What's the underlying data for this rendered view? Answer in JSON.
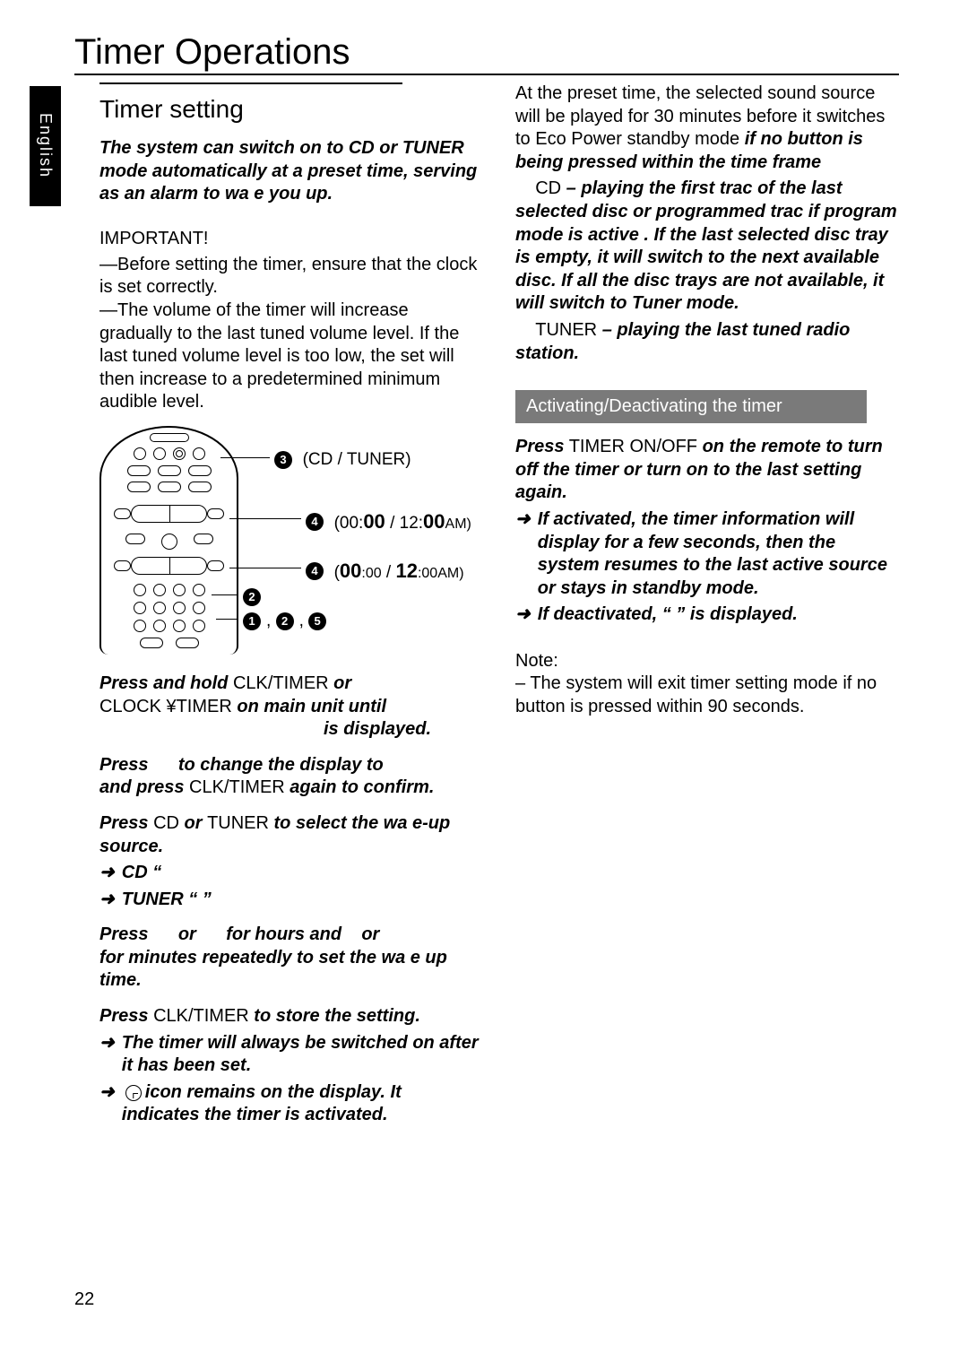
{
  "page_title": "Timer Operations",
  "language_tab": "English",
  "page_number": "22",
  "left": {
    "section_title": "Timer setting",
    "intro": "The system can switch on to CD or TUNER mode automatically at a preset time, serving as an alarm to wa e you up.",
    "important_head": "IMPORTANT!",
    "important_p1": "—Before setting the timer, ensure that the clock is set correctly.",
    "important_p2": "—The volume of the timer will increase gradually to the last tuned volume level. If the last tuned volume level is too low, the set will then increase to a predetermined minimum audible level.",
    "callouts": {
      "c3": "(CD / TUNER)",
      "c4a_pre": "(00:",
      "c4a_big": "00",
      "c4a_mid": " / 12:",
      "c4a_big2": "00",
      "c4a_post": "AM)",
      "c4b_big1": "00",
      "c4b_small": ":00",
      "c4b_mid": " / ",
      "c4b_big2": "12",
      "c4b_post": ":00AM)"
    },
    "step1_a": "Press and hold",
    "step1_b": "CLK/TIMER",
    "step1_c": "  or",
    "step1_d": "CLOCK ¥TIMER",
    "step1_e": " on main unit  until",
    "step1_f": "is displayed.",
    "step2_a": "Press",
    "step2_b": "to change the display to",
    "step2_c": "and press",
    "step2_d": "CLK/TIMER",
    "step2_e": " again to confirm.",
    "step3_a": "Press",
    "step3_b": "CD",
    "step3_c": " or ",
    "step3_d": "TUNER",
    "step3_e": " to select the wa e-up source.",
    "step3_cd": "CD    “",
    "step3_tuner": "TUNER    “           ”",
    "step4_a": "Press",
    "step4_b": "or",
    "step4_c": "for hours  and",
    "step4_d": "or",
    "step4_e": " for minutes  repeatedly to set the wa e up time.",
    "step5_a": "Press",
    "step5_b": "CLK/TIMER",
    "step5_c": " to store the setting.",
    "step5_sub1": "The timer will always be switched on after it has been set.",
    "step5_sub2_a": "",
    "step5_sub2_b": "icon remains on the display. It indicates the timer is activated."
  },
  "right": {
    "preset_p1_a": "At the preset time, the selected sound source will be played for 30 minutes before it switches to Eco Power standby mode",
    "preset_p1_b": "if no button is being pressed within the time frame",
    "cd_label": "CD",
    "cd_text": " – playing the first trac   of the last selected disc or programmed trac    if program mode is active .  If the last selected disc tray is empty, it will switch to the next available disc.  If all the disc trays are not available, it will switch to Tuner mode.",
    "tuner_label": "TUNER",
    "tuner_text": "– playing the last tuned radio station.",
    "grey_header": "Activating/Deactivating the timer",
    "act_p1_a": "Press",
    "act_p1_b": "TIMER ON/OFF",
    "act_p1_c": "  on the remote to turn off the timer or turn on to the last setting again.",
    "act_sub1": "If activated, the timer information will display for a few seconds, then the system resumes to the last active source or stays in standby mode.",
    "act_sub2": "If deactivated, “   ” is displayed.",
    "note_head": "Note:",
    "note_body": "–  The system will exit timer setting mode if no button is pressed within 90 seconds."
  }
}
